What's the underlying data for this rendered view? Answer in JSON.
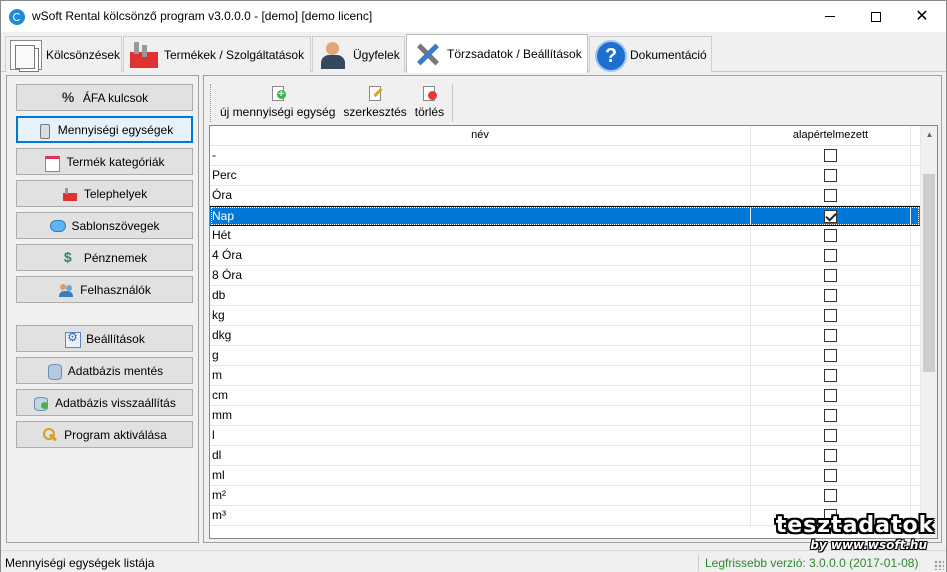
{
  "window": {
    "title": "wSoft Rental kölcsönző program v3.0.0.0 - [demo] [demo licenc]"
  },
  "main_tabs": [
    {
      "label": "Kölcsönzések",
      "icon": "documents-icon",
      "active": false
    },
    {
      "label": "Termékek / Szolgáltatások",
      "icon": "factory-icon",
      "active": false
    },
    {
      "label": "Ügyfelek",
      "icon": "client-icon",
      "active": false
    },
    {
      "label": "Törzsadatok / Beállítások",
      "icon": "tools-icon",
      "active": true
    },
    {
      "label": "Dokumentáció",
      "icon": "help-icon",
      "active": false
    }
  ],
  "sidebar": {
    "items": [
      {
        "label": "ÁFA kulcsok",
        "icon": "percent-icon"
      },
      {
        "label": "Mennyiségi egységek",
        "icon": "bottle-icon",
        "selected": true
      },
      {
        "label": "Termék kategóriák",
        "icon": "calendar-icon"
      },
      {
        "label": "Telephelyek",
        "icon": "factory-icon"
      },
      {
        "label": "Sablonszövegek",
        "icon": "speech-bubble-icon"
      },
      {
        "label": "Pénznemek",
        "icon": "money-icon"
      },
      {
        "label": "Felhasználók",
        "icon": "users-icon"
      },
      {
        "label": "Beállítások",
        "icon": "settings-icon"
      },
      {
        "label": "Adatbázis mentés",
        "icon": "database-save-icon"
      },
      {
        "label": "Adatbázis visszaállítás",
        "icon": "database-restore-icon"
      },
      {
        "label": "Program aktiválása",
        "icon": "key-icon"
      }
    ]
  },
  "toolbar": {
    "new_label": "új mennyiségi egység",
    "edit_label": "szerkesztés",
    "delete_label": "törlés"
  },
  "grid": {
    "columns": {
      "name": "név",
      "default": "alapértelmezett"
    },
    "rows": [
      {
        "name": "-",
        "default": false
      },
      {
        "name": "Perc",
        "default": false
      },
      {
        "name": "Óra",
        "default": false
      },
      {
        "name": "Nap",
        "default": true,
        "selected": true
      },
      {
        "name": "Hét",
        "default": false
      },
      {
        "name": "4 Óra",
        "default": false
      },
      {
        "name": "8 Óra",
        "default": false
      },
      {
        "name": "db",
        "default": false
      },
      {
        "name": "kg",
        "default": false
      },
      {
        "name": "dkg",
        "default": false
      },
      {
        "name": "g",
        "default": false
      },
      {
        "name": "m",
        "default": false
      },
      {
        "name": "cm",
        "default": false
      },
      {
        "name": "mm",
        "default": false
      },
      {
        "name": "l",
        "default": false
      },
      {
        "name": "dl",
        "default": false
      },
      {
        "name": "ml",
        "default": false
      },
      {
        "name": "m²",
        "default": false
      },
      {
        "name": "m³",
        "default": false
      }
    ]
  },
  "status": {
    "left": "Mennyiségi egységek listája",
    "right": "Legfrissebb verzió: 3.0.0.0 (2017-01-08)"
  },
  "watermark": {
    "title": "tesztadatok",
    "url": "by www.wsoft.hu"
  }
}
